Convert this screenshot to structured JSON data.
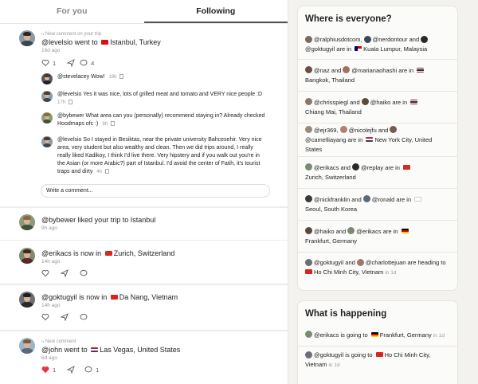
{
  "tabs": [
    {
      "label": "For you"
    },
    {
      "label": "Following"
    }
  ],
  "feed": {
    "post1": {
      "sub_label": "New comment on your trip",
      "user": "@levelsio",
      "went_to": "went to",
      "place": "Istanbul, Turkey",
      "flag": "tr",
      "time": "16d ago",
      "likes": "1",
      "comments": "4",
      "thread": [
        {
          "user": "@stevelacey",
          "text": "Wow!",
          "time": "19h"
        },
        {
          "user": "@levelsio",
          "text": "Yes it was nice, lots of grilled meat and tomato and VERY nice people :D",
          "time": "17h"
        },
        {
          "user": "@bybewer",
          "text": "What area can you (personally) recommend staying in? Already checked Hoodmaps ofc :)",
          "time": "9h"
        },
        {
          "user": "@levelsio",
          "text": "So I stayed in Besiktas, near the private university Bahcesehir. Very nice area, very student but also wealthy and clean. Then we did trips around, I really really liked Kadikoy, I think I'd live there. Very hipstery and if you walk out you're in the Asian (or more Arabic?) part of Istanbul. I'd avoid the center of Fatih, it's tourist traps and dirty",
          "time": "4h"
        }
      ],
      "comment_value": "Write a comment..."
    },
    "post2": {
      "user": "@bybewer",
      "text": "liked your trip to Istanbul",
      "time": "9h ago"
    },
    "post3": {
      "user": "@erikacs",
      "text": "is now in",
      "place": "Zurich, Switzerland",
      "flag": "ch",
      "time": "14h ago"
    },
    "post4": {
      "user": "@goktugyil",
      "text": "is now in",
      "place": "Da Nang, Vietnam",
      "flag": "vn",
      "time": "14h ago"
    },
    "post5": {
      "sub_label": "New comment",
      "user": "@john",
      "text": "went to",
      "place": "Las Vegas, United States",
      "flag": "us",
      "time": "6d ago",
      "likes": "1",
      "comments": "1"
    }
  },
  "where": {
    "title": "Where is everyone?",
    "rows": [
      {
        "line1": "@ralphiusdotcom, ",
        "u2": "@nerdontour",
        "and": " and ",
        "line2a": "@goktugyil",
        "are": " are in ",
        "place": "Kuala Lumpur, Malaysia",
        "flag": "my"
      },
      {
        "u1": "@naz",
        "and": " and ",
        "u2": "@marianaohashi",
        "are": " are in ",
        "place": "Bangkok, Thailand",
        "flag": "th"
      },
      {
        "u1": "@chrisspiegl",
        "and": " and ",
        "u2": "@haiko",
        "are": " are in ",
        "place": "Chiang Mai, Thailand",
        "flag": "th"
      },
      {
        "u1": "@ejr369, ",
        "u2": "@nicolejfu",
        "and": " and ",
        "u3": "@camelliayang",
        "are": " are in ",
        "place": "New York City, United States",
        "flag": "us"
      },
      {
        "u1": "@erikacs",
        "and": " and ",
        "u2": "@replay",
        "are": " are in ",
        "place": "Zurich, Switzerland",
        "flag": "ch"
      },
      {
        "u1": "@nickfranklin",
        "and": " and ",
        "u2": "@ronald",
        "are": " are in ",
        "place": "Seoul, South Korea",
        "flag": "kr"
      },
      {
        "u1": "@haiko",
        "and": " and ",
        "u2": "@erikacs",
        "are": " are in ",
        "place": "Frankfurt, Germany",
        "flag": "de"
      },
      {
        "u1": "@goktugyil",
        "and": " and ",
        "u2": "@charlottejuan",
        "are": " are heading to ",
        "place": "Ho Chi Minh City, Vietnam",
        "flag": "vn",
        "ago": "in 1d"
      }
    ]
  },
  "happening": {
    "title": "What is happening",
    "rows": [
      {
        "user": "@erikacs",
        "text": " is going to ",
        "place": "Frankfurt, Germany",
        "flag": "de",
        "ago": "in 1d"
      },
      {
        "user": "@goktugyil",
        "text": " is going to ",
        "place": "Ho Chi Minh City, Vietnam",
        "flag": "vn",
        "ago": "in 1d"
      }
    ]
  },
  "colors": {
    "heart": "#e0384b",
    "accent": "#222222",
    "muted": "#999999"
  }
}
